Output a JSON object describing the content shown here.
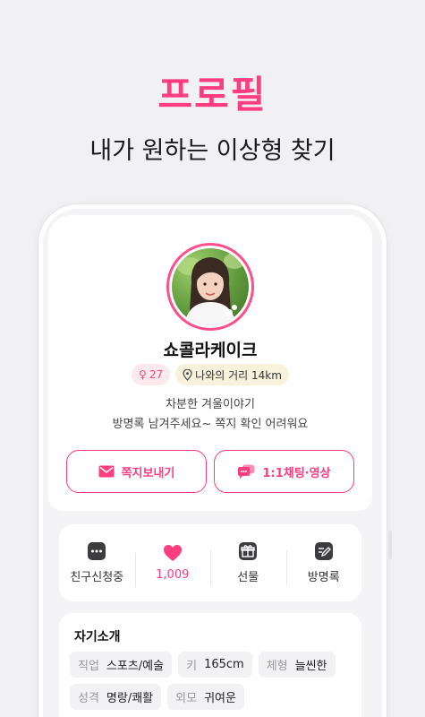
{
  "headline": "프로필",
  "subheadline": "내가 원하는 이상형 찾기",
  "profile": {
    "nickname": "쇼콜라케이크",
    "age": "27",
    "distance": "나와의 거리 14km",
    "bio_line1": "차분한 겨울이야기",
    "bio_line2": "방명록 남겨주세요~ 쪽지 확인 어려워요"
  },
  "buttons": {
    "message": "쪽지보내기",
    "chat": "1:1채팅·영상"
  },
  "actions": [
    {
      "label": "친구신청중",
      "icon": "chat-dots-icon"
    },
    {
      "label": "1,009",
      "icon": "heart-icon"
    },
    {
      "label": "선물",
      "icon": "gift-icon"
    },
    {
      "label": "방명록",
      "icon": "guestbook-icon"
    }
  ],
  "intro": {
    "title": "자기소개",
    "tags": [
      {
        "key": "직업",
        "value": "스포츠/예술"
      },
      {
        "key": "키",
        "value": "165cm"
      },
      {
        "key": "체형",
        "value": "늘씬한"
      },
      {
        "key": "성격",
        "value": "명랑/쾌활"
      },
      {
        "key": "외모",
        "value": "귀여운"
      }
    ]
  },
  "colors": {
    "accent": "#ff3d7f",
    "background": "#f1f1f3"
  }
}
